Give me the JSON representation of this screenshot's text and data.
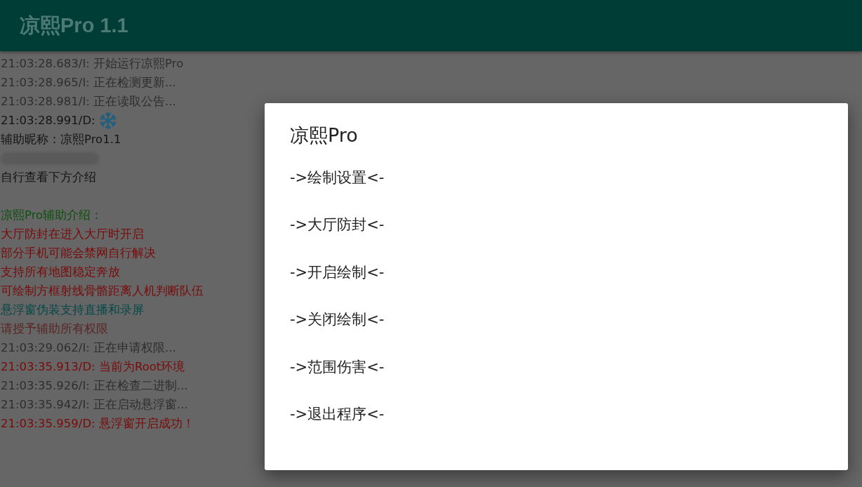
{
  "app_bar": {
    "title": "凉熙Pro 1.1"
  },
  "log": [
    {
      "kind": "text",
      "text": "21:03:28.683/I: 开始运行凉熙Pro",
      "color": "#2e2e2e"
    },
    {
      "kind": "text",
      "text": "21:03:28.965/I: 正在检测更新...",
      "color": "#2e2e2e"
    },
    {
      "kind": "text",
      "text": "21:03:28.981/I: 正在读取公告...",
      "color": "#2e2e2e"
    },
    {
      "kind": "snowflake",
      "text": "21:03:28.991/D:",
      "color": "#141414"
    },
    {
      "kind": "text",
      "text": "辅助昵称：凉熙Pro1.1",
      "color": "#141414"
    },
    {
      "kind": "redacted"
    },
    {
      "kind": "text",
      "text": "自行查看下方介绍",
      "color": "#141414"
    },
    {
      "kind": "blank"
    },
    {
      "kind": "text",
      "text": "凉熙Pro辅助介绍：",
      "color": "#0d500d"
    },
    {
      "kind": "text",
      "text": "大厅防封在进入大厅时开启",
      "color": "#7a0a0a"
    },
    {
      "kind": "text",
      "text": "部分手机可能会禁网自行解决",
      "color": "#7a0a0a"
    },
    {
      "kind": "text",
      "text": "支持所有地图稳定奔放",
      "color": "#7a0a0a"
    },
    {
      "kind": "text",
      "text": "可绘制方框射线骨骼距离人机判断队伍",
      "color": "#7a0a0a"
    },
    {
      "kind": "text",
      "text": "悬浮窗伪装支持直播和录屏",
      "color": "#064848"
    },
    {
      "kind": "text",
      "text": "请授予辅助所有权限",
      "color": "#5a2424"
    },
    {
      "kind": "text",
      "text": "21:03:29.062/I: 正在申请权限...",
      "color": "#2e2e2e"
    },
    {
      "kind": "text",
      "text": "21:03:35.913/D: 当前为Root环境",
      "color": "#7a0a0a"
    },
    {
      "kind": "text",
      "text": "21:03:35.926/I: 正在检查二进制...",
      "color": "#2e2e2e"
    },
    {
      "kind": "text",
      "text": "21:03:35.942/I: 正在启动悬浮窗...",
      "color": "#2e2e2e"
    },
    {
      "kind": "text",
      "text": "21:03:35.959/D: 悬浮窗开启成功！",
      "color": "#7a0a0a"
    }
  ],
  "dialog": {
    "title": "凉熙Pro",
    "items": [
      "->绘制设置<-",
      "->大厅防封<-",
      "->开启绘制<-",
      "->关闭绘制<-",
      "->范围伤害<-",
      "->退出程序<-"
    ]
  }
}
